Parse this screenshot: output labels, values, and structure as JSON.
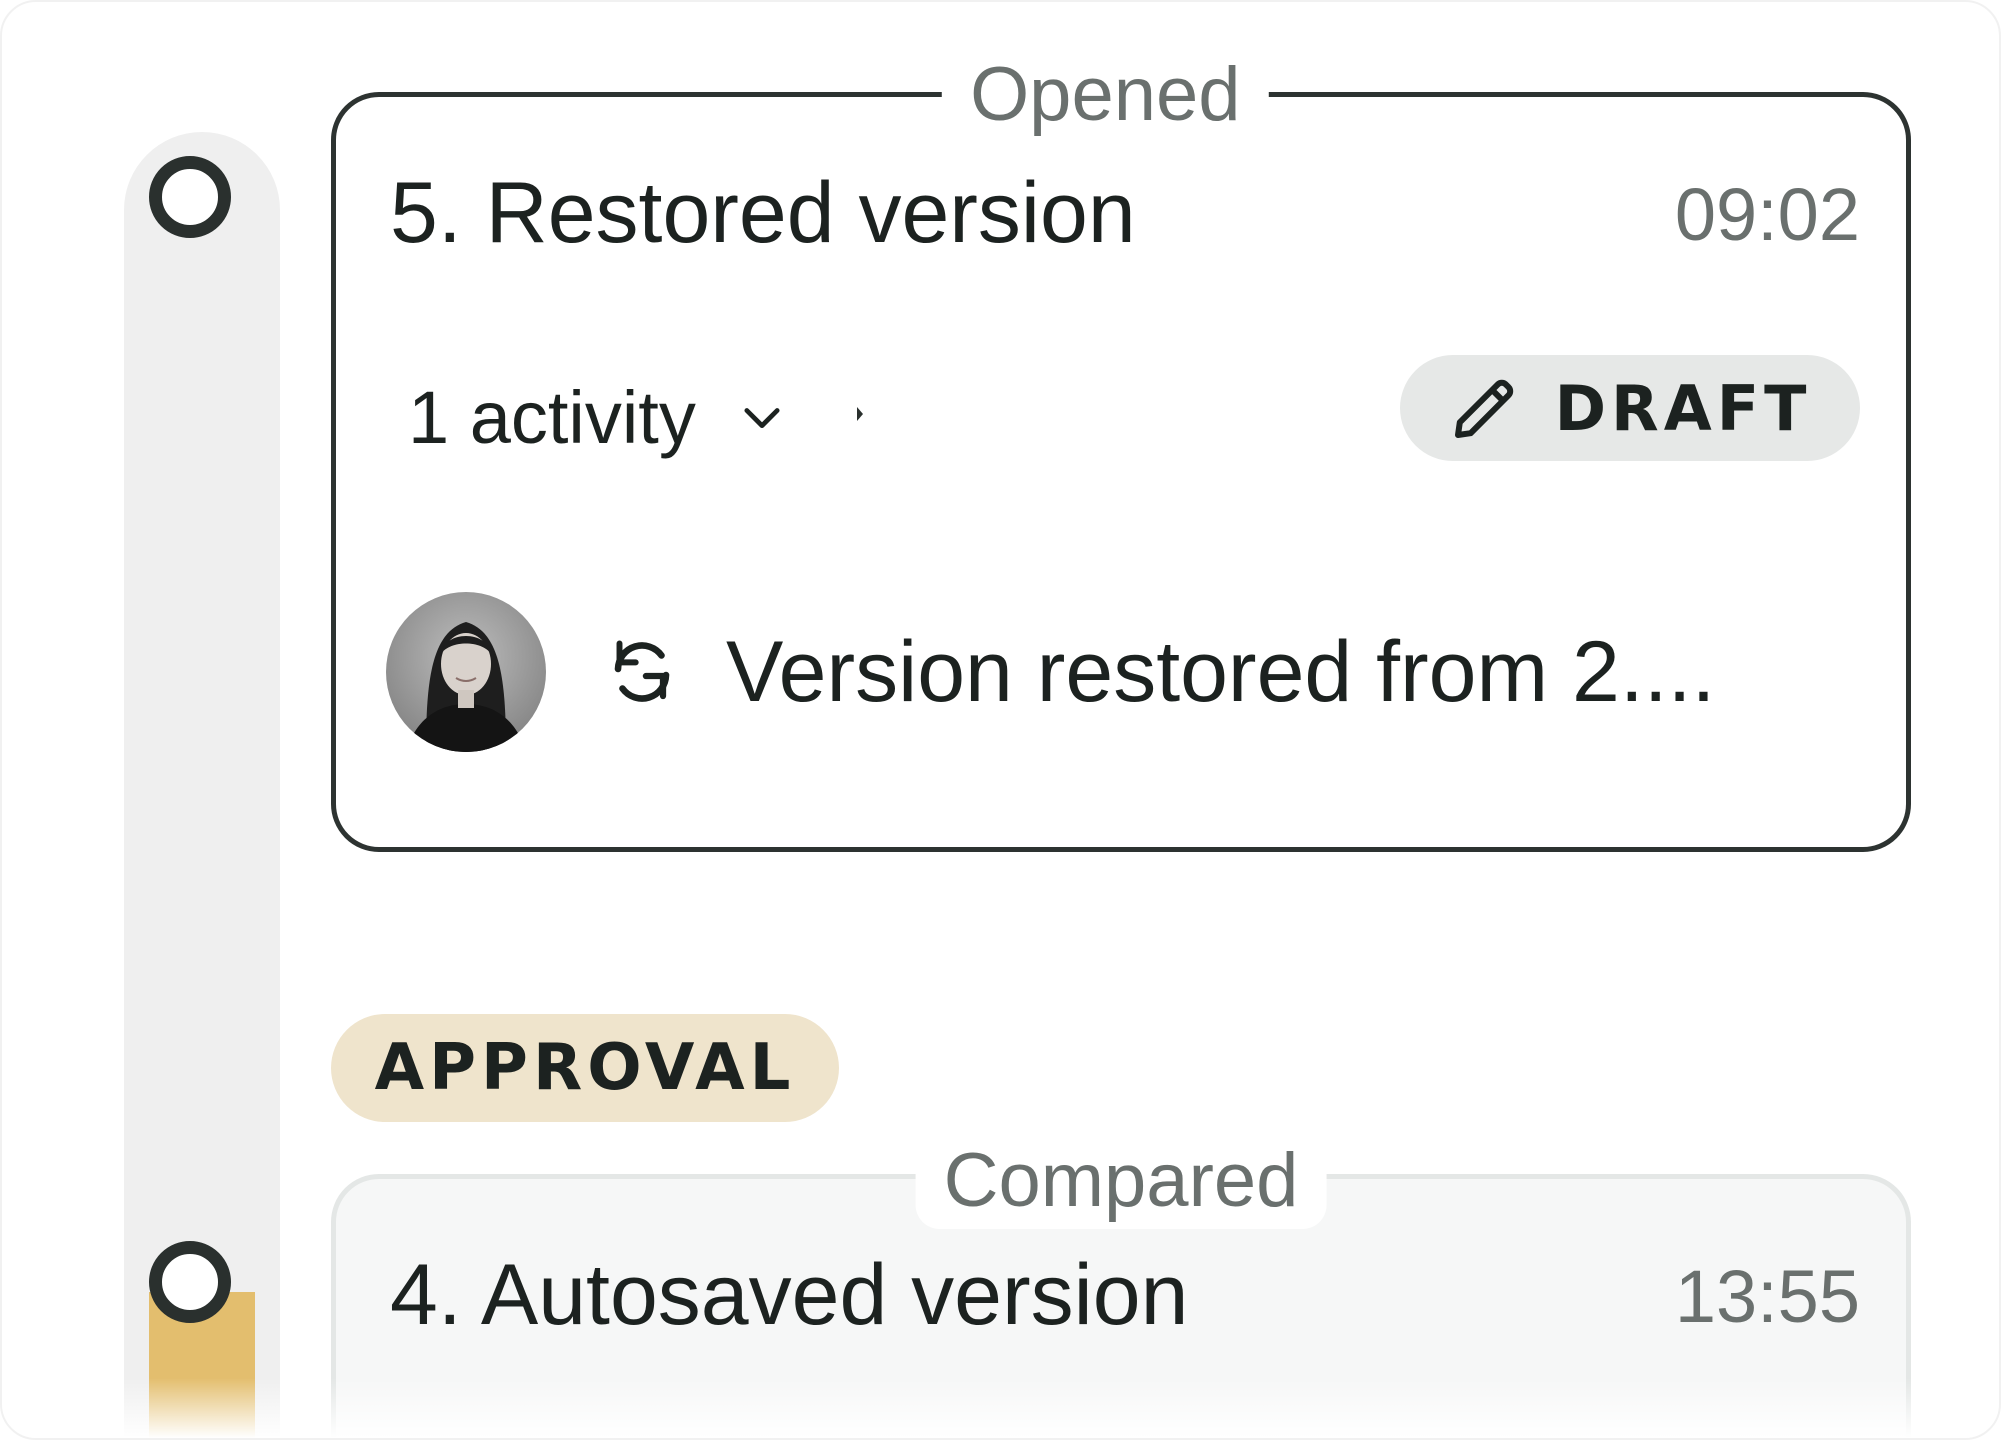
{
  "timeline": {
    "accent_color": "#e3be6e",
    "rail_color": "#efefef"
  },
  "versions": [
    {
      "legend": "Opened",
      "title": "5. Restored version",
      "time": "09:02",
      "activity_summary": "1 activity",
      "status_badge": {
        "label": "DRAFT",
        "icon": "pencil-icon"
      },
      "entries": [
        {
          "avatar": "user-avatar",
          "icon": "restore-icon",
          "text": "Version restored from 2...."
        }
      ]
    },
    {
      "legend": "Compared",
      "title": "4. Autosaved version",
      "time": "13:55"
    }
  ],
  "section_badge": {
    "label": "APPROVAL",
    "color": "#efe4cc"
  }
}
